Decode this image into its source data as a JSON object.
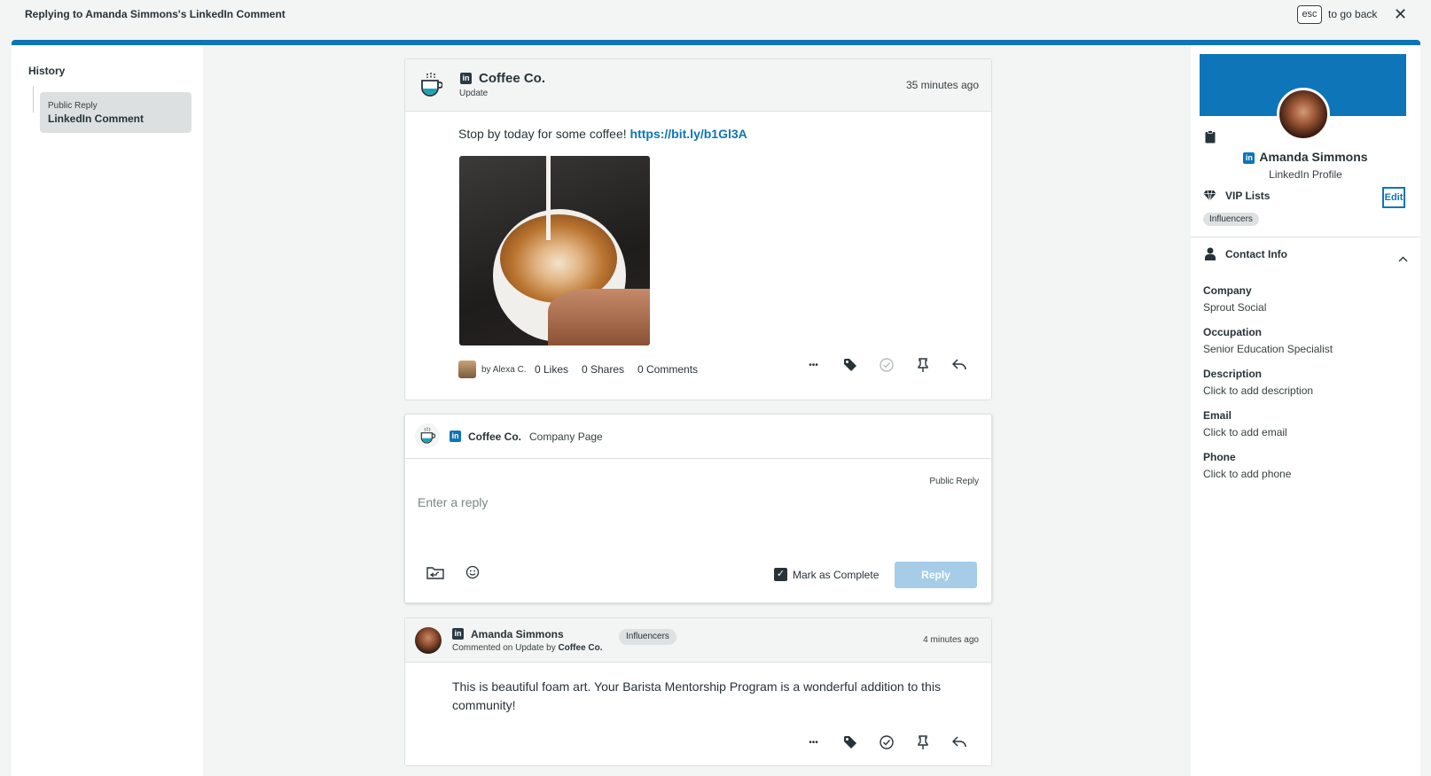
{
  "topbar": {
    "title": "Replying to Amanda Simmons's LinkedIn Comment",
    "esc_key": "esc",
    "go_back": "to go back",
    "close_glyph": "✕"
  },
  "history": {
    "heading": "History",
    "item_type": "Public Reply",
    "item_title": "LinkedIn Comment"
  },
  "post": {
    "author": "Coffee Co.",
    "type": "Update",
    "time": "35 minutes ago",
    "text": "Stop by today for some coffee!",
    "link": "https://bit.ly/b1Gl3A",
    "byline": "by Alexa C.",
    "likes": "0 Likes",
    "shares": "0 Shares",
    "comments": "0 Comments"
  },
  "composer": {
    "author": "Coffee Co.",
    "page_type": "Company Page",
    "reply_type": "Public Reply",
    "placeholder": "Enter a reply",
    "mark_complete": "Mark as Complete",
    "reply_button": "Reply"
  },
  "comment": {
    "author": "Amanda Simmons",
    "meta_prefix": "Commented on Update by",
    "meta_target": "Coffee Co.",
    "tag": "Influencers",
    "time": "4 minutes ago",
    "text": "This is beautiful foam art. Your Barista Mentorship Program is a wonderful addition to this community!"
  },
  "profile": {
    "name": "Amanda Simmons",
    "subtitle": "LinkedIn Profile",
    "vip_label": "VIP Lists",
    "edit": "Edit",
    "vip_tag": "Influencers",
    "contact_heading": "Contact Info",
    "fields": [
      {
        "label": "Company",
        "value": "Sprout Social"
      },
      {
        "label": "Occupation",
        "value": "Senior Education Specialist"
      },
      {
        "label": "Description",
        "value": "Click to add description"
      },
      {
        "label": "Email",
        "value": "Click to add email"
      },
      {
        "label": "Phone",
        "value": "Click to add phone"
      }
    ]
  },
  "icons": {
    "linkedin": "in",
    "more": "•••",
    "tag": "tag-icon",
    "complete": "check-circle-icon",
    "pin": "pin-icon",
    "reply": "reply-icon"
  },
  "colors": {
    "accent": "#0e75b8",
    "reply_disabled": "#a6cce8",
    "background": "#f3f4f4"
  }
}
